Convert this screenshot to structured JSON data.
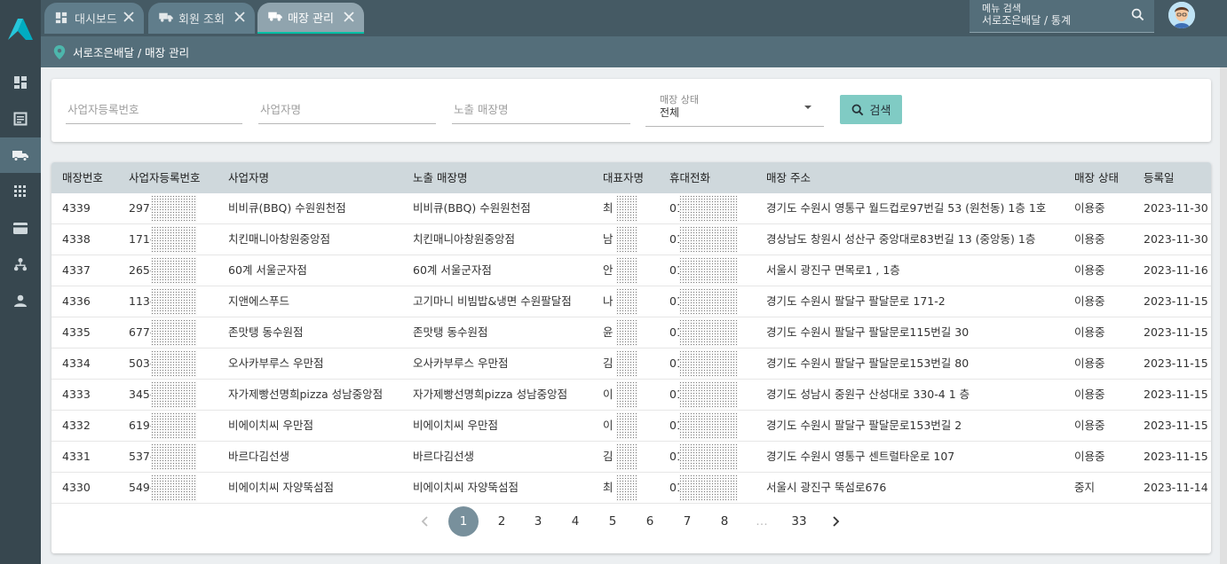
{
  "tabs": [
    {
      "label": "대시보드",
      "icon": "dashboard-icon"
    },
    {
      "label": "회원 조회",
      "icon": "truck-icon"
    },
    {
      "label": "매장 관리",
      "icon": "truck-icon"
    }
  ],
  "menu_search": {
    "label": "메뉴 검색",
    "value": "서로조은배달 / 통계"
  },
  "breadcrumb": "서로조은배달 / 매장 관리",
  "sidebar": {
    "items": [
      {
        "name": "dashboard-icon"
      },
      {
        "name": "list-icon"
      },
      {
        "name": "truck-icon"
      },
      {
        "name": "grid-icon"
      },
      {
        "name": "card-icon"
      },
      {
        "name": "org-chart-icon"
      },
      {
        "name": "person-icon"
      }
    ],
    "active_index": 2
  },
  "filters": {
    "biz_reg_no_placeholder": "사업자등록번호",
    "biz_name_placeholder": "사업자명",
    "store_display_name_placeholder": "노출 매장명",
    "status_label": "매장 상태",
    "status_value": "전체",
    "search_label": "검색"
  },
  "table": {
    "headers": {
      "store_no": "매장번호",
      "biz_reg_no": "사업자등록번호",
      "biz_name": "사업자명",
      "display_name": "노출 매장명",
      "owner": "대표자명",
      "phone": "휴대전화",
      "address": "매장 주소",
      "status": "매장 상태",
      "date": "등록일"
    },
    "rows": [
      {
        "store_no": "4339",
        "biz_reg_no": "297-",
        "biz_name": "비비큐(BBQ) 수원원천점",
        "display_name": "비비큐(BBQ) 수원원천점",
        "owner": "최",
        "phone": "01",
        "address": "경기도 수원시 영통구 월드컵로97번길 53 (원천동) 1층 1호",
        "status": "이용중",
        "date": "2023-11-30"
      },
      {
        "store_no": "4338",
        "biz_reg_no": "171-",
        "biz_name": "치킨매니아창원중앙점",
        "display_name": "치킨매니아창원중앙점",
        "owner": "남",
        "phone": "01",
        "address": "경상남도 창원시 성산구 중앙대로83번길 13 (중앙동) 1층",
        "status": "이용중",
        "date": "2023-11-30"
      },
      {
        "store_no": "4337",
        "biz_reg_no": "265-",
        "biz_name": "60계 서울군자점",
        "display_name": "60계 서울군자점",
        "owner": "안",
        "phone": "01",
        "address": "서울시 광진구 면목로1 , 1층",
        "status": "이용중",
        "date": "2023-11-16"
      },
      {
        "store_no": "4336",
        "biz_reg_no": "113-",
        "biz_name": "지앤에스푸드",
        "display_name": "고기마니 비빔밥&냉면 수원팔달점",
        "owner": "나",
        "phone": "01",
        "address": "경기도 수원시 팔달구 팔달문로 171-2",
        "status": "이용중",
        "date": "2023-11-15"
      },
      {
        "store_no": "4335",
        "biz_reg_no": "677-",
        "biz_name": "존맛탱 동수원점",
        "display_name": "존맛탱 동수원점",
        "owner": "윤",
        "phone": "01",
        "address": "경기도 수원시 팔달구 팔달문로115번길 30",
        "status": "이용중",
        "date": "2023-11-15"
      },
      {
        "store_no": "4334",
        "biz_reg_no": "503-",
        "biz_name": "오사카부루스 우만점",
        "display_name": "오사카부루스 우만점",
        "owner": "김",
        "phone": "01",
        "address": "경기도 수원시 팔달구 팔달문로153번길 80",
        "status": "이용중",
        "date": "2023-11-15"
      },
      {
        "store_no": "4333",
        "biz_reg_no": "345-",
        "biz_name": "자가제빵선명희pizza 성남중앙점",
        "display_name": "자가제빵선명희pizza 성남중앙점",
        "owner": "이",
        "phone": "01",
        "address": "경기도 성남시 중원구 산성대로 330-4  1 층",
        "status": "이용중",
        "date": "2023-11-15"
      },
      {
        "store_no": "4332",
        "biz_reg_no": "619-",
        "biz_name": "비에이치씨 우만점",
        "display_name": "비에이치씨 우만점",
        "owner": "이",
        "phone": "01",
        "address": "경기도 수원시 팔달구 팔달문로153번길 2",
        "status": "이용중",
        "date": "2023-11-15"
      },
      {
        "store_no": "4331",
        "biz_reg_no": "537-",
        "biz_name": "바르다김선생",
        "display_name": "바르다김선생",
        "owner": "김",
        "phone": "01",
        "address": "경기도 수원시 영통구 센트럴타운로 107",
        "status": "이용중",
        "date": "2023-11-15"
      },
      {
        "store_no": "4330",
        "biz_reg_no": "549-",
        "biz_name": "비에이치씨 자양뚝섬점",
        "display_name": "비에이치씨 자양뚝섬점",
        "owner": "최",
        "phone": "01",
        "address": "서울시 광진구 뚝섬로676",
        "status": "중지",
        "date": "2023-11-14"
      }
    ]
  },
  "pagination": {
    "pages": [
      "1",
      "2",
      "3",
      "4",
      "5",
      "6",
      "7",
      "8",
      "…",
      "33"
    ],
    "current": "1"
  },
  "colors": {
    "sidebar": "#37474f",
    "topbar": "#455a64",
    "accent": "#00bfa5",
    "search_button": "#80cbc4",
    "active_page": "#78909c"
  }
}
